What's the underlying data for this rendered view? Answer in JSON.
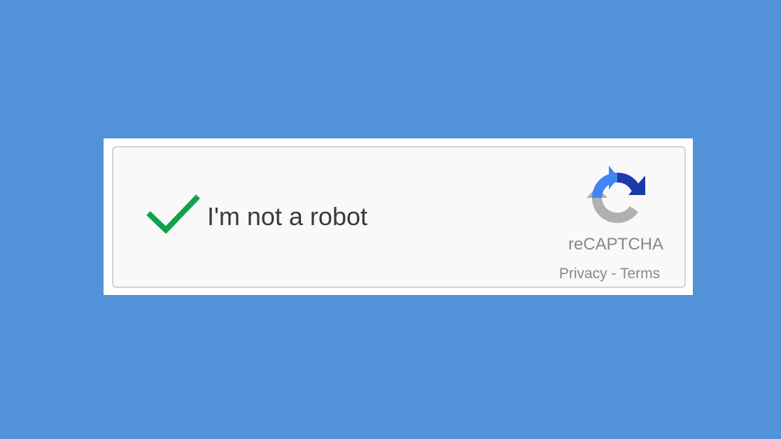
{
  "widget": {
    "checkbox_state": "checked",
    "label": "I'm not a robot",
    "logo_icon": "recaptcha-logo-icon",
    "brand": "reCAPTCHA",
    "privacy_link": "Privacy",
    "separator": " - ",
    "terms_link": "Terms"
  },
  "colors": {
    "background": "#5192d9",
    "check": "#0fa24b",
    "logo_blue": "#4285f4",
    "logo_dark_blue": "#1c3aa9",
    "logo_gray": "#b0b0b0"
  }
}
